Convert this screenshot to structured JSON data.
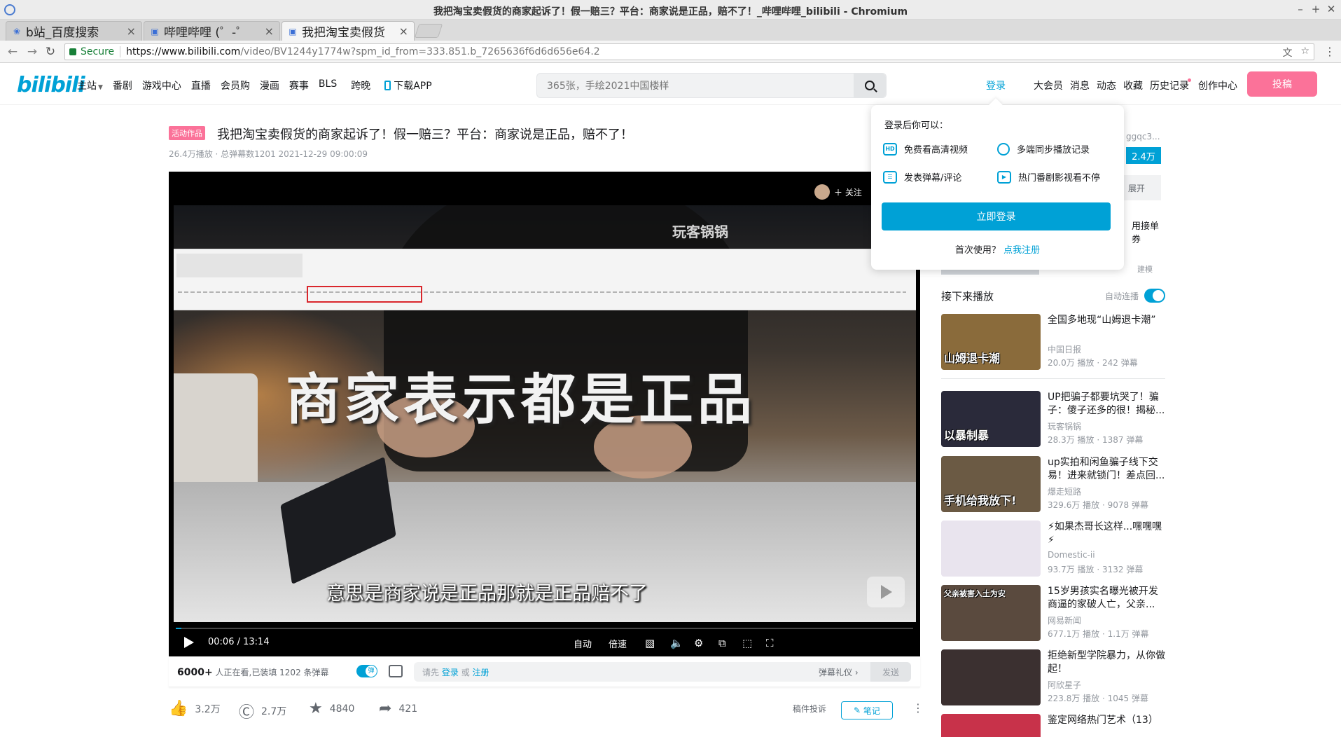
{
  "browser": {
    "window_title": "我把淘宝卖假货的商家起诉了！假一赔三？平台：商家说是正品，赔不了！_哔哩哔哩_bilibili - Chromium",
    "tabs": [
      {
        "label": "b站_百度搜索",
        "icon": "baidu-paw-icon",
        "active": false
      },
      {
        "label": "哔哩哔哩 (゜-゜",
        "icon": "bilibili-tv-icon",
        "active": false
      },
      {
        "label": "我把淘宝卖假货",
        "icon": "bilibili-tv-icon",
        "active": true
      }
    ],
    "secure_label": "Secure",
    "url_host": "https://www.bilibili.com",
    "url_path": "/video/BV1244y1774w?spm_id_from=333.851.b_7265636f6d6d656e64.2"
  },
  "header": {
    "logo": "bilibili",
    "nav_left": [
      "主站",
      "番剧",
      "游戏中心",
      "直播",
      "会员购",
      "漫画",
      "赛事",
      "BLS",
      "跨晚",
      "下载APP"
    ],
    "search_placeholder": "365张，手绘2021中国楼样",
    "login": "登录",
    "nav_right": [
      "大会员",
      "消息",
      "动态",
      "收藏",
      "历史记录",
      "创作中心"
    ],
    "upload": "投稿"
  },
  "video": {
    "tag": "活动作品",
    "title": "我把淘宝卖假货的商家起诉了！假一赔三？平台：商家说是正品，赔不了！",
    "meta": "26.4万播放 · 总弹幕数1201    2021-12-29 09:00:09",
    "overlay_big_text": "商家表示都是正品",
    "subtitle": "意思是商家说是正品那就是正品赔不了",
    "watermark": "玩客锅锅",
    "follow_label": "关注",
    "current_time": "00:06",
    "duration": "13:14",
    "progress_fraction": 0.0076,
    "controls": {
      "auto": "自动",
      "speed": "倍速"
    }
  },
  "danmaku": {
    "online_count": "6000+",
    "online_text": "人正在看,已装填 1202 条弹幕",
    "hint_prefix": "请先",
    "hint_login": "登录",
    "hint_or": "或",
    "hint_register": "注册",
    "etiquette": "弹幕礼仪 ›",
    "send": "发送"
  },
  "actions": {
    "like": "3.2万",
    "coin": "2.7万",
    "fav": "4840",
    "share": "421",
    "report": "稿件投诉",
    "note": "笔记"
  },
  "sidebar": {
    "up_name": "ggqc3...",
    "follow_count": "2.4万",
    "expand": "展开",
    "partial_text": "用接单券",
    "partial_sub": "建模",
    "next_up": "接下来播放",
    "autoplay": "自动连播",
    "recs": [
      {
        "title": "全国多地现“山姆退卡潮”",
        "author": "中国日报",
        "stats": "20.0万 播放 · 242 弹幕",
        "thumb_text": "山姆退卡潮",
        "color": "#8a6b3b"
      },
      {
        "title": "UP把骗子都要坑哭了！骗子：傻子还多的很！揭秘...",
        "author": "玩客锅锅",
        "stats": "28.3万 播放 · 1387 弹幕",
        "thumb_text": "以暴制暴",
        "color": "#2a2a3a"
      },
      {
        "title": "up实拍和闲鱼骗子线下交易！进来就锁门！差点回...",
        "author": "爆走短路",
        "stats": "329.6万 播放 · 9078 弹幕",
        "thumb_text": "手机给我放下!",
        "color": "#6b5a44"
      },
      {
        "title": "⚡如果杰哥长这样...嘿嘿嘿⚡",
        "author": "Domestic-ii",
        "stats": "93.7万 播放 · 3132 弹幕",
        "thumb_text": "",
        "color": "#e9e4ee"
      },
      {
        "title": "15岁男孩实名曝光被开发商逼的家破人亡，父亲...",
        "author": "网易新闻",
        "stats": "677.1万 播放 · 1.1万 弹幕",
        "thumb_text": "父亲被害入土为安",
        "color": "#5a4a3e"
      },
      {
        "title": "拒绝新型学院暴力，从你做起！",
        "author": "阿欣星子",
        "stats": "223.8万 播放 · 1045 弹幕",
        "thumb_text": "",
        "color": "#3b3030"
      },
      {
        "title": "鉴定网络热门艺术（13）",
        "author": "",
        "stats": "",
        "thumb_text": "",
        "color": "#c8324a"
      }
    ]
  },
  "login_popover": {
    "head": "登录后你可以：",
    "benefits": [
      "免费看高清视频",
      "多端同步播放记录",
      "发表弹幕/评论",
      "热门番剧影视看不停"
    ],
    "login_now": "立即登录",
    "first_use": "首次使用？",
    "register": "点我注册"
  }
}
